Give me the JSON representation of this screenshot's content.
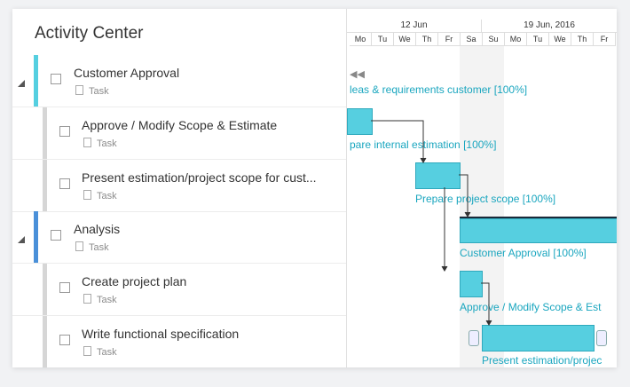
{
  "title": "Activity Center",
  "rows": [
    {
      "label": "Customer Approval",
      "type": "Task",
      "level": 0,
      "bar_color": "#55cfe0"
    },
    {
      "label": "Approve / Modify Scope & Estimate",
      "type": "Task",
      "level": 1,
      "bar_color": "#d6d6d6"
    },
    {
      "label": "Present estimation/project scope for cust...",
      "type": "Task",
      "level": 1,
      "bar_color": "#d6d6d6"
    },
    {
      "label": "Analysis",
      "type": "Task",
      "level": 0,
      "bar_color": "#4a90d9"
    },
    {
      "label": "Create project plan",
      "type": "Task",
      "level": 1,
      "bar_color": "#d6d6d6"
    },
    {
      "label": "Write functional specification",
      "type": "Task",
      "level": 1,
      "bar_color": "#d6d6d6"
    }
  ],
  "gantt": {
    "weeks": [
      "12 Jun",
      "19 Jun, 2016"
    ],
    "days": [
      "Mo",
      "Tu",
      "We",
      "Th",
      "Fr",
      "Sa",
      "Su",
      "Mo",
      "Tu",
      "We",
      "Th",
      "Fr"
    ],
    "labels": [
      "leas & requirements customer [100%]",
      "pare internal estimation [100%]",
      "Prepare project scope [100%]",
      "Customer Approval [100%]",
      "Approve / Modify Scope & Est",
      "Present estimation/projec"
    ],
    "collapse_icon": "double-chevron-left-icon"
  }
}
